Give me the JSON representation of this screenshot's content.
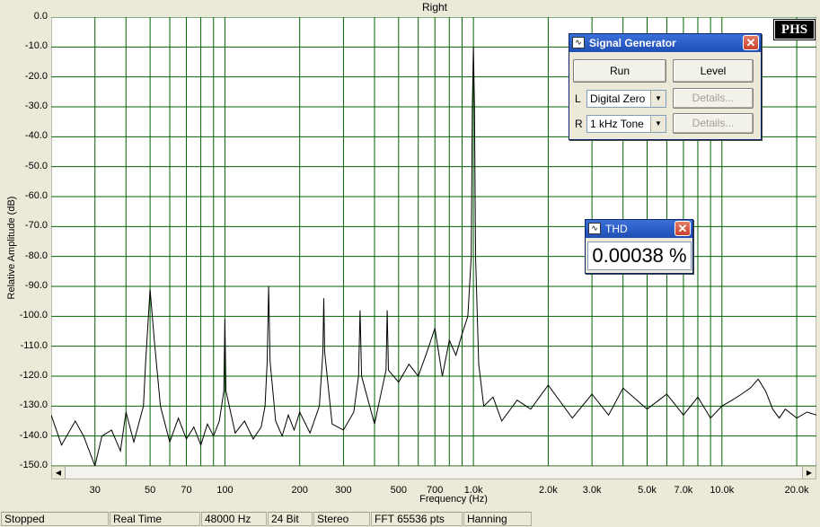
{
  "plot": {
    "title": "Right",
    "ylabel": "Relative Amplitude (dB)",
    "xlabel": "Frequency (Hz)",
    "logo": "PHS"
  },
  "chart_data": {
    "type": "line",
    "title": "Right",
    "xlabel": "Frequency (Hz)",
    "ylabel": "Relative Amplitude (dB)",
    "xscale": "log",
    "xlim": [
      20,
      24000
    ],
    "ylim": [
      -150,
      0
    ],
    "grid": true,
    "y_ticks": [
      "0.0",
      "-10.0",
      "-20.0",
      "-30.0",
      "-40.0",
      "-50.0",
      "-60.0",
      "-70.0",
      "-80.0",
      "-90.0",
      "-100.0",
      "-110.0",
      "-120.0",
      "-130.0",
      "-140.0",
      "-150.0"
    ],
    "y_tick_values": [
      0,
      -10,
      -20,
      -30,
      -40,
      -50,
      -60,
      -70,
      -80,
      -90,
      -100,
      -110,
      -120,
      -130,
      -140,
      -150
    ],
    "x_ticks": [
      "30",
      "50",
      "70",
      "100",
      "200",
      "300",
      "500",
      "700",
      "1.0k",
      "2.0k",
      "3.0k",
      "5.0k",
      "7.0k",
      "10.0k",
      "20.0k"
    ],
    "x_tick_values": [
      30,
      50,
      70,
      100,
      200,
      300,
      500,
      700,
      1000,
      2000,
      3000,
      5000,
      7000,
      10000,
      20000
    ],
    "series": [
      {
        "x": [
          20,
          22,
          25,
          27,
          30,
          32,
          35,
          38,
          40,
          43,
          45,
          47,
          48,
          50,
          52,
          55,
          60,
          65,
          70,
          75,
          80,
          85,
          90,
          95,
          99,
          100,
          101,
          110,
          120,
          130,
          140,
          145,
          148,
          150,
          152,
          160,
          170,
          180,
          190,
          200,
          220,
          240,
          248,
          250,
          252,
          270,
          300,
          330,
          345,
          350,
          355,
          400,
          445,
          450,
          455,
          500,
          550,
          600,
          650,
          700,
          750,
          800,
          850,
          900,
          950,
          980,
          990,
          1000,
          1010,
          1020,
          1050,
          1100,
          1200,
          1300,
          1500,
          1700,
          2000,
          2500,
          3000,
          3500,
          4000,
          5000,
          6000,
          7000,
          8000,
          9000,
          10000,
          11000,
          12000,
          13000,
          14000,
          15000,
          16000,
          17000,
          18000,
          20000,
          22000,
          24000
        ],
        "y": [
          -133,
          -143,
          -135,
          -140,
          -150,
          -140,
          -138,
          -145,
          -132,
          -142,
          -136,
          -130,
          -115,
          -91,
          -108,
          -130,
          -142,
          -134,
          -141,
          -137,
          -143,
          -136,
          -140,
          -135,
          -125,
          -101,
          -125,
          -139,
          -135,
          -141,
          -137,
          -130,
          -115,
          -90,
          -115,
          -135,
          -140,
          -133,
          -138,
          -132,
          -139,
          -130,
          -112,
          -94,
          -112,
          -136,
          -138,
          -132,
          -120,
          -98,
          -120,
          -136,
          -118,
          -98,
          -118,
          -122,
          -116,
          -120,
          -112,
          -104,
          -120,
          -108,
          -113,
          -106,
          -100,
          -80,
          -30,
          -10,
          -30,
          -80,
          -116,
          -130,
          -127,
          -135,
          -128,
          -131,
          -123,
          -134,
          -126,
          -133,
          -124,
          -131,
          -126,
          -133,
          -127,
          -134,
          -130,
          -128,
          -126,
          -124,
          -121,
          -125,
          -131,
          -134,
          -131,
          -134,
          -132,
          -133
        ]
      }
    ]
  },
  "signal_generator": {
    "title": "Signal Generator",
    "run_label": "Run",
    "level_label": "Level",
    "left_label": "L",
    "right_label": "R",
    "left_value": "Digital Zero",
    "right_value": "1 kHz Tone",
    "details_label": "Details..."
  },
  "thd": {
    "title": "THD",
    "value": "0.00038 %"
  },
  "status": {
    "state": "Stopped",
    "mode": "Real Time",
    "sample_rate": "48000 Hz",
    "bit_depth": "24 Bit",
    "channels": "Stereo",
    "fft_size": "FFT 65536 pts",
    "window": "Hanning"
  },
  "colors": {
    "plot_bg": "#ffffff",
    "grid": "#006400",
    "trace": "#000000",
    "titlebar": "#2a5bc4"
  }
}
